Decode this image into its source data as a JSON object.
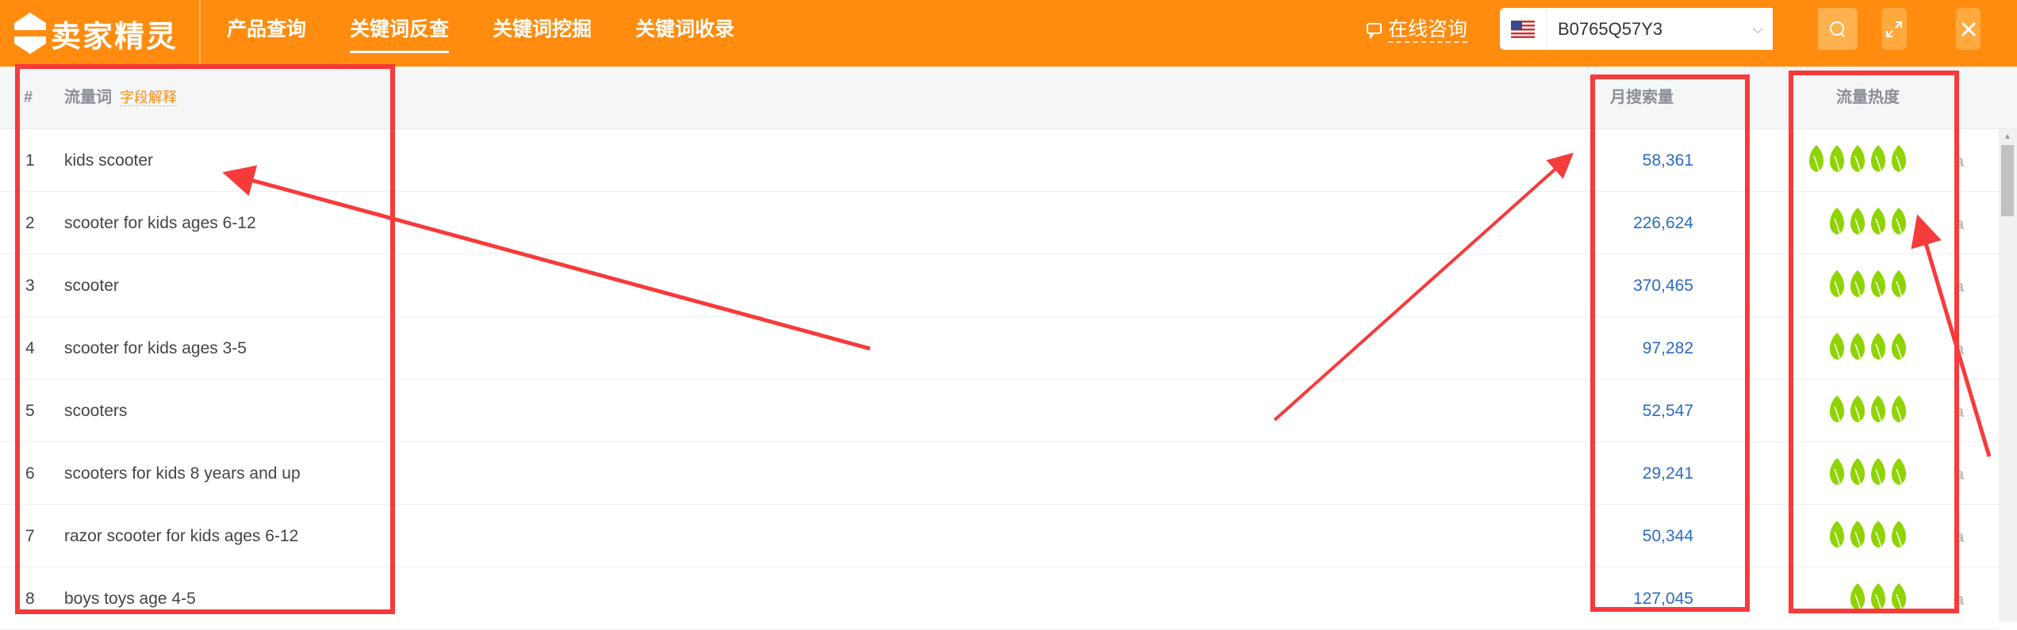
{
  "app": {
    "name": "卖家精灵",
    "brand_color": "#ff8c0f"
  },
  "nav": [
    {
      "label": "产品查询",
      "active": false
    },
    {
      "label": "关键词反查",
      "active": true
    },
    {
      "label": "关键词挖掘",
      "active": false
    },
    {
      "label": "关键词收录",
      "active": false
    }
  ],
  "consult_label": "在线咨询",
  "search": {
    "marketplace": "US",
    "value": "B0765Q57Y3"
  },
  "table": {
    "headers": {
      "index": "#",
      "keyword": "流量词",
      "explain": "字段解释",
      "monthly": "月搜索量",
      "heat": "流量热度"
    },
    "rows": [
      {
        "i": "1",
        "kw": "kids scooter",
        "vol": "58,361",
        "heat": 5
      },
      {
        "i": "2",
        "kw": "scooter for kids ages 6-12",
        "vol": "226,624",
        "heat": 4
      },
      {
        "i": "3",
        "kw": "scooter",
        "vol": "370,465",
        "heat": 4
      },
      {
        "i": "4",
        "kw": "scooter for kids ages 3-5",
        "vol": "97,282",
        "heat": 4
      },
      {
        "i": "5",
        "kw": "scooters",
        "vol": "52,547",
        "heat": 4
      },
      {
        "i": "6",
        "kw": "scooters for kids 8 years and up",
        "vol": "29,241",
        "heat": 4
      },
      {
        "i": "7",
        "kw": "razor scooter for kids ages 6-12",
        "vol": "50,344",
        "heat": 4
      },
      {
        "i": "8",
        "kw": "boys toys age 4-5",
        "vol": "127,045",
        "heat": 3
      }
    ]
  },
  "colors": {
    "leaf": "#8fd400",
    "annotation": "#f73a3a",
    "number": "#2a6bc4"
  }
}
